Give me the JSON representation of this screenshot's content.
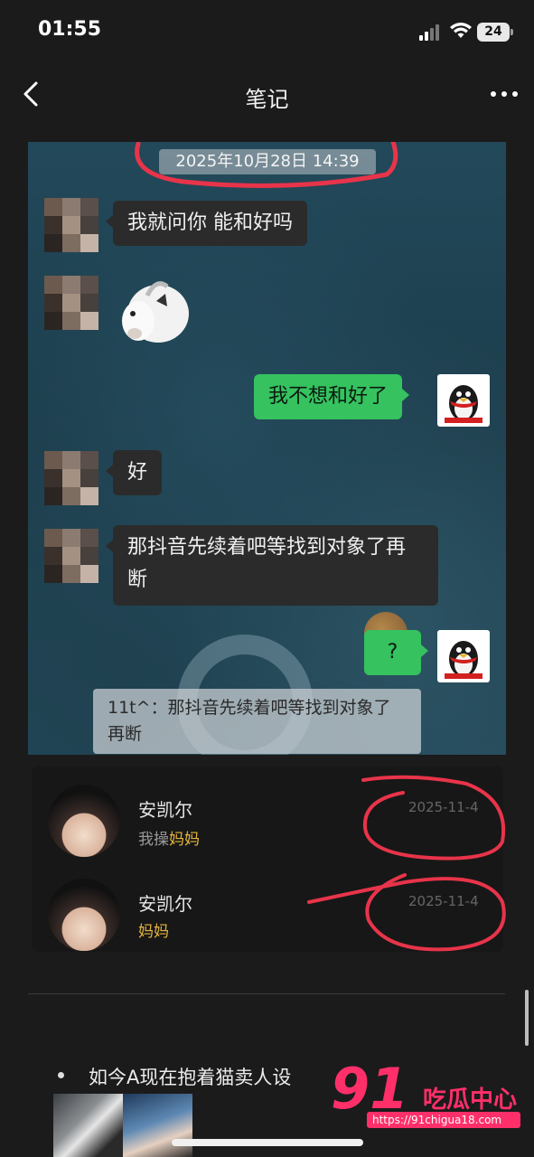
{
  "status_bar": {
    "time": "01:55",
    "battery": "24"
  },
  "nav": {
    "title": "笔记"
  },
  "chat": {
    "timestamp": "2025年10月28日 14:39",
    "messages": [
      {
        "side": "in",
        "text": "我就问你 能和好吗"
      },
      {
        "side": "in",
        "type": "sticker",
        "sticker": "goat-sticker"
      },
      {
        "side": "out",
        "text": "我不想和好了"
      },
      {
        "side": "in",
        "text": "好"
      },
      {
        "side": "in",
        "text": "那抖音先续着吧等找到对象了再断"
      },
      {
        "side": "out",
        "text": "?"
      }
    ],
    "quote": "11t^：那抖音先续着吧等找到对象了再断"
  },
  "comments": [
    {
      "name": "安凯尔",
      "text_prefix": "我操",
      "text_highlight": "妈妈",
      "date": "2025-11-4"
    },
    {
      "name": "安凯尔",
      "text_prefix": "",
      "text_highlight": "妈妈",
      "date": "2025-11-4"
    }
  ],
  "article": {
    "bullet_text": "如今A现在抱着猫卖人设"
  },
  "watermark": {
    "number": "91",
    "name": "吃瓜中心",
    "url": "https://91chigua18.com"
  },
  "colors": {
    "accent_green": "#35c25f",
    "highlight_gold": "#e4b53c",
    "watermark_pink": "#ff2f6a",
    "annotation_red": "#e8344a"
  }
}
